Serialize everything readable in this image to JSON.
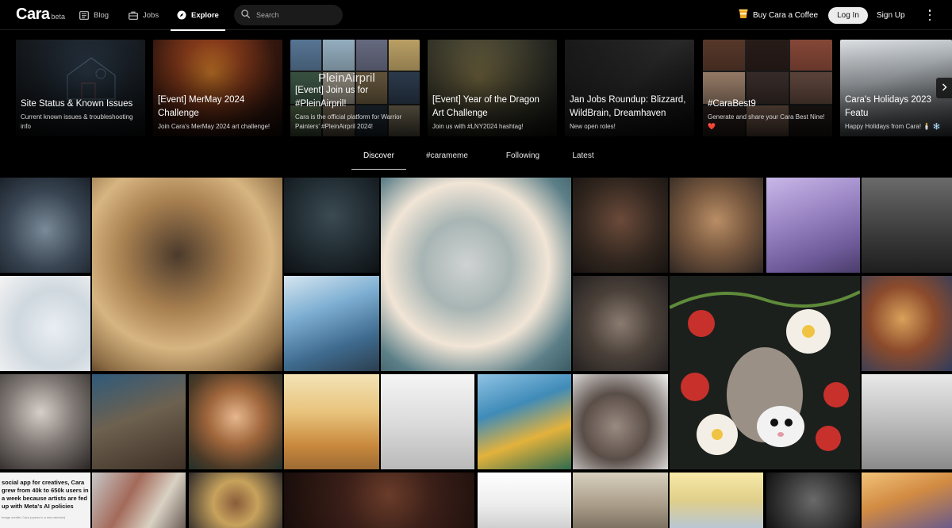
{
  "brand": {
    "name": "Cara",
    "badge": "beta"
  },
  "nav": {
    "blog": "Blog",
    "jobs": "Jobs",
    "explore": "Explore",
    "search_placeholder": "Search",
    "coffee": "Buy Cara a Coffee",
    "login": "Log In",
    "signup": "Sign Up"
  },
  "featured": [
    {
      "title": "Site Status & Known Issues",
      "subtitle": "Current known issues & troubleshooting info"
    },
    {
      "title": "[Event] MerMay 2024 Challenge",
      "subtitle": "Join Cara's MerMay 2024 art challenge!"
    },
    {
      "title": "[Event] Join us for #PleinAirpril!",
      "subtitle": "Cara is the official platform for Warrior Painters' #PleinAirpril 2024!",
      "overlay": "PleinAirpril"
    },
    {
      "title": "[Event] Year of the Dragon Art Challenge",
      "subtitle": "Join us with #LNY2024 hashtag!"
    },
    {
      "title": "Jan Jobs Roundup: Blizzard, WildBrain, Dreamhaven",
      "subtitle": "New open roles!"
    },
    {
      "title": "#CaraBest9",
      "subtitle": "Generate and share your Cara Best Nine! ❤️"
    },
    {
      "title": "Cara's Holidays 2023 Featu",
      "subtitle": "Happy Holidays from Cara! 🕯️ ❄️"
    }
  ],
  "tabs": [
    "Discover",
    "#carameme",
    "Following",
    "Latest"
  ],
  "active_tab": "Discover",
  "gallery_news": {
    "headline": "social app for creatives, Cara grew from 40k to 650k users in a week because artists are fed up with Meta's AI policies",
    "caption": "Image credits: Cara (opens in a new window)"
  },
  "colors": {
    "background": "#000000",
    "accent_coffee": "#f5a623",
    "heart": "#e0245e"
  }
}
